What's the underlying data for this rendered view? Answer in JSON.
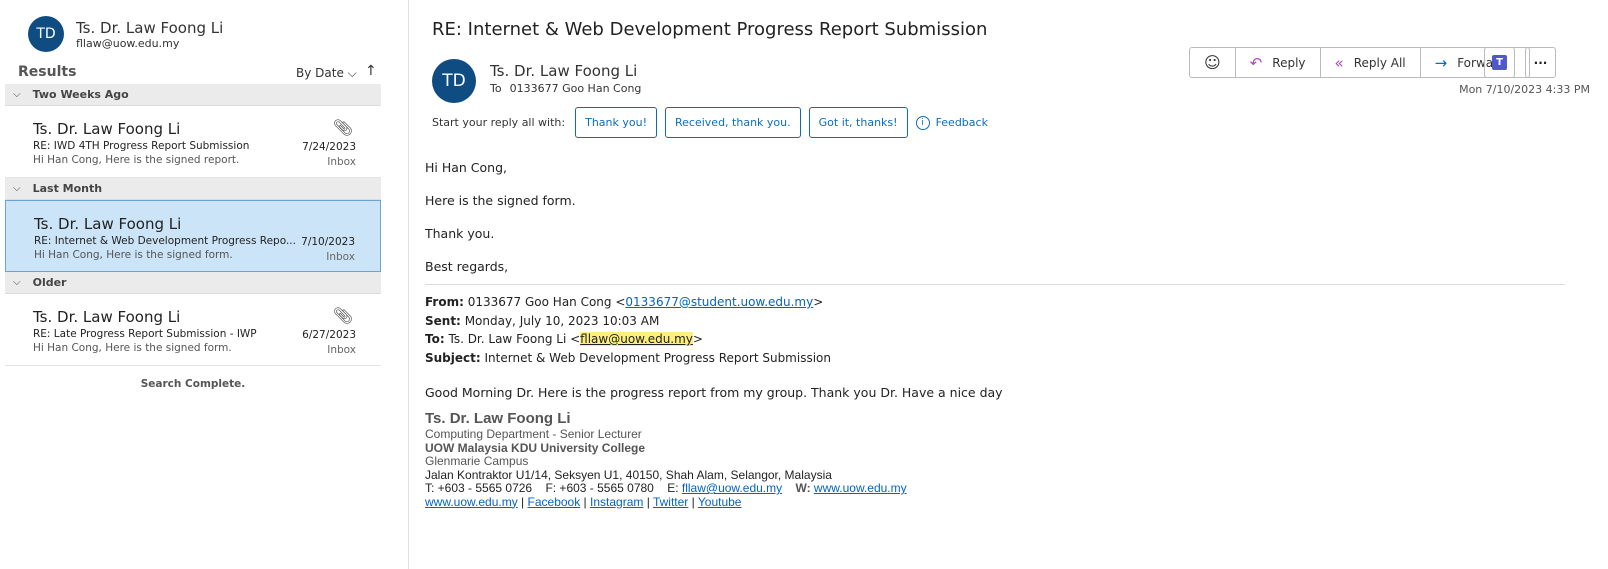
{
  "account": {
    "initials": "TD",
    "name": "Ts. Dr. Law Foong Li",
    "email": "fllaw@uow.edu.my"
  },
  "results": {
    "title": "Results",
    "sort": "By Date",
    "sort_dir": "↑"
  },
  "groups": [
    {
      "label": "Two Weeks Ago",
      "items": [
        {
          "from": "Ts. Dr. Law Foong Li",
          "subject": "RE: IWD 4TH Progress Report Submission",
          "preview": "Hi Han Cong,  Here is the signed report.",
          "date": "7/24/2023",
          "folder": "Inbox",
          "attachment": true
        }
      ]
    },
    {
      "label": "Last Month",
      "items": [
        {
          "from": "Ts. Dr. Law Foong Li",
          "subject": "RE: Internet & Web Development Progress Repo...",
          "preview": "Hi Han Cong,  Here is the signed form.",
          "date": "7/10/2023",
          "folder": "Inbox",
          "attachment": false,
          "selected": true
        }
      ]
    },
    {
      "label": "Older",
      "items": [
        {
          "from": "Ts. Dr. Law Foong Li",
          "subject": "RE: Late Progress Report Submission - IWP",
          "preview": "Hi Han Cong,  Here is the signed form.",
          "date": "6/27/2023",
          "folder": "Inbox",
          "attachment": true
        }
      ]
    }
  ],
  "search_status": "Search Complete.",
  "message": {
    "title": "RE: Internet & Web Development Progress Report Submission",
    "initials": "TD",
    "sender": "Ts. Dr. Law Foong Li",
    "to_label": "To",
    "to": "0133677 Goo Han Cong",
    "timestamp": "Mon 7/10/2023 4:33 PM",
    "actions": {
      "reply": "Reply",
      "reply_all": "Reply All",
      "forward": "Forward"
    },
    "quick_reply": {
      "label": "Start your reply all with:",
      "options": [
        "Thank you!",
        "Received, thank you.",
        "Got it, thanks!"
      ],
      "feedback": "Feedback"
    },
    "body": [
      "Hi Han Cong,",
      "Here is the signed form.",
      "Thank you.",
      "Best regards,"
    ],
    "quoted": {
      "from_label": "From:",
      "from": "0133677 Goo Han Cong <",
      "from_email": "0133677@student.uow.edu.my",
      "sent_label": "Sent:",
      "sent": "Monday, July 10, 2023 10:03 AM",
      "to_label": "To:",
      "to": "Ts. Dr. Law Foong Li <",
      "to_email": "fllaw@uow.edu.my",
      "subject_label": "Subject:",
      "subject": "Internet & Web Development Progress Report Submission",
      "text": "Good Morning Dr. Here is the progress report from my group. Thank you Dr. Have a nice day"
    },
    "signature": {
      "name": "Ts. Dr. Law Foong Li",
      "dept": "Computing Department - Senior Lecturer",
      "org": "UOW Malaysia KDU University College",
      "campus": "Glenmarie Campus",
      "address": "Jalan Kontraktor U1/14, Seksyen U1, 40150, Shah Alam, Selangor, Malaysia",
      "tel": "T: +603 - 5565 0726",
      "fax": "F: +603 - 5565 0780",
      "e_label": "E:",
      "email": "fllaw@uow.edu.my",
      "w_label": "W:",
      "web": "www.uow.edu.my",
      "links": [
        "www.uow.edu.my",
        "Facebook",
        "Instagram",
        "Twitter",
        "Youtube"
      ]
    }
  }
}
